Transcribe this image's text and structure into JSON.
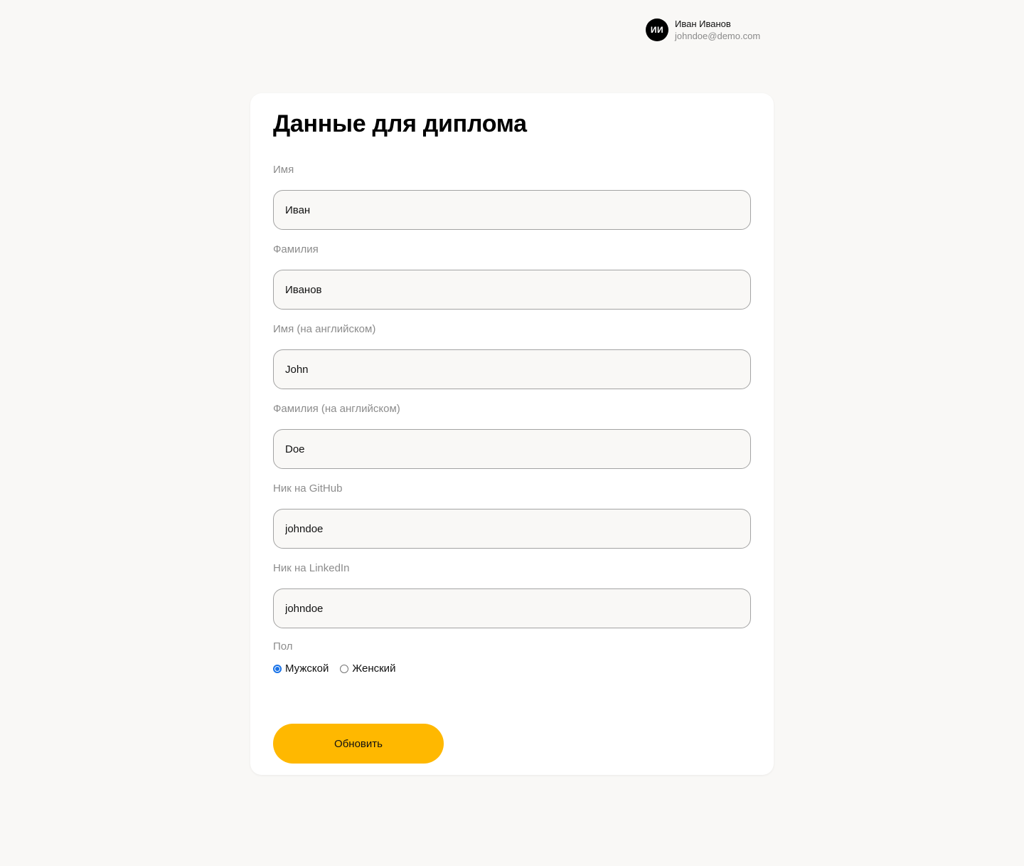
{
  "user": {
    "initials": "ИИ",
    "name": "Иван Иванов",
    "email": "johndoe@demo.com"
  },
  "form": {
    "title": "Данные для диплома",
    "fields": [
      {
        "label": "Имя",
        "value": "Иван"
      },
      {
        "label": "Фамилия",
        "value": "Иванов"
      },
      {
        "label": "Имя (на английском)",
        "value": "John"
      },
      {
        "label": "Фамилия (на английском)",
        "value": "Doe"
      },
      {
        "label": "Ник на GitHub",
        "value": "johndoe"
      },
      {
        "label": "Ник на LinkedIn",
        "value": "johndoe"
      }
    ],
    "gender": {
      "label": "Пол",
      "options": [
        {
          "label": "Мужской",
          "checked": true
        },
        {
          "label": "Женский",
          "checked": false
        }
      ]
    },
    "submit_label": "Обновить"
  },
  "colors": {
    "accent": "#ffb800",
    "background": "#f9f8f6",
    "radio_checked": "#1a73e8"
  }
}
